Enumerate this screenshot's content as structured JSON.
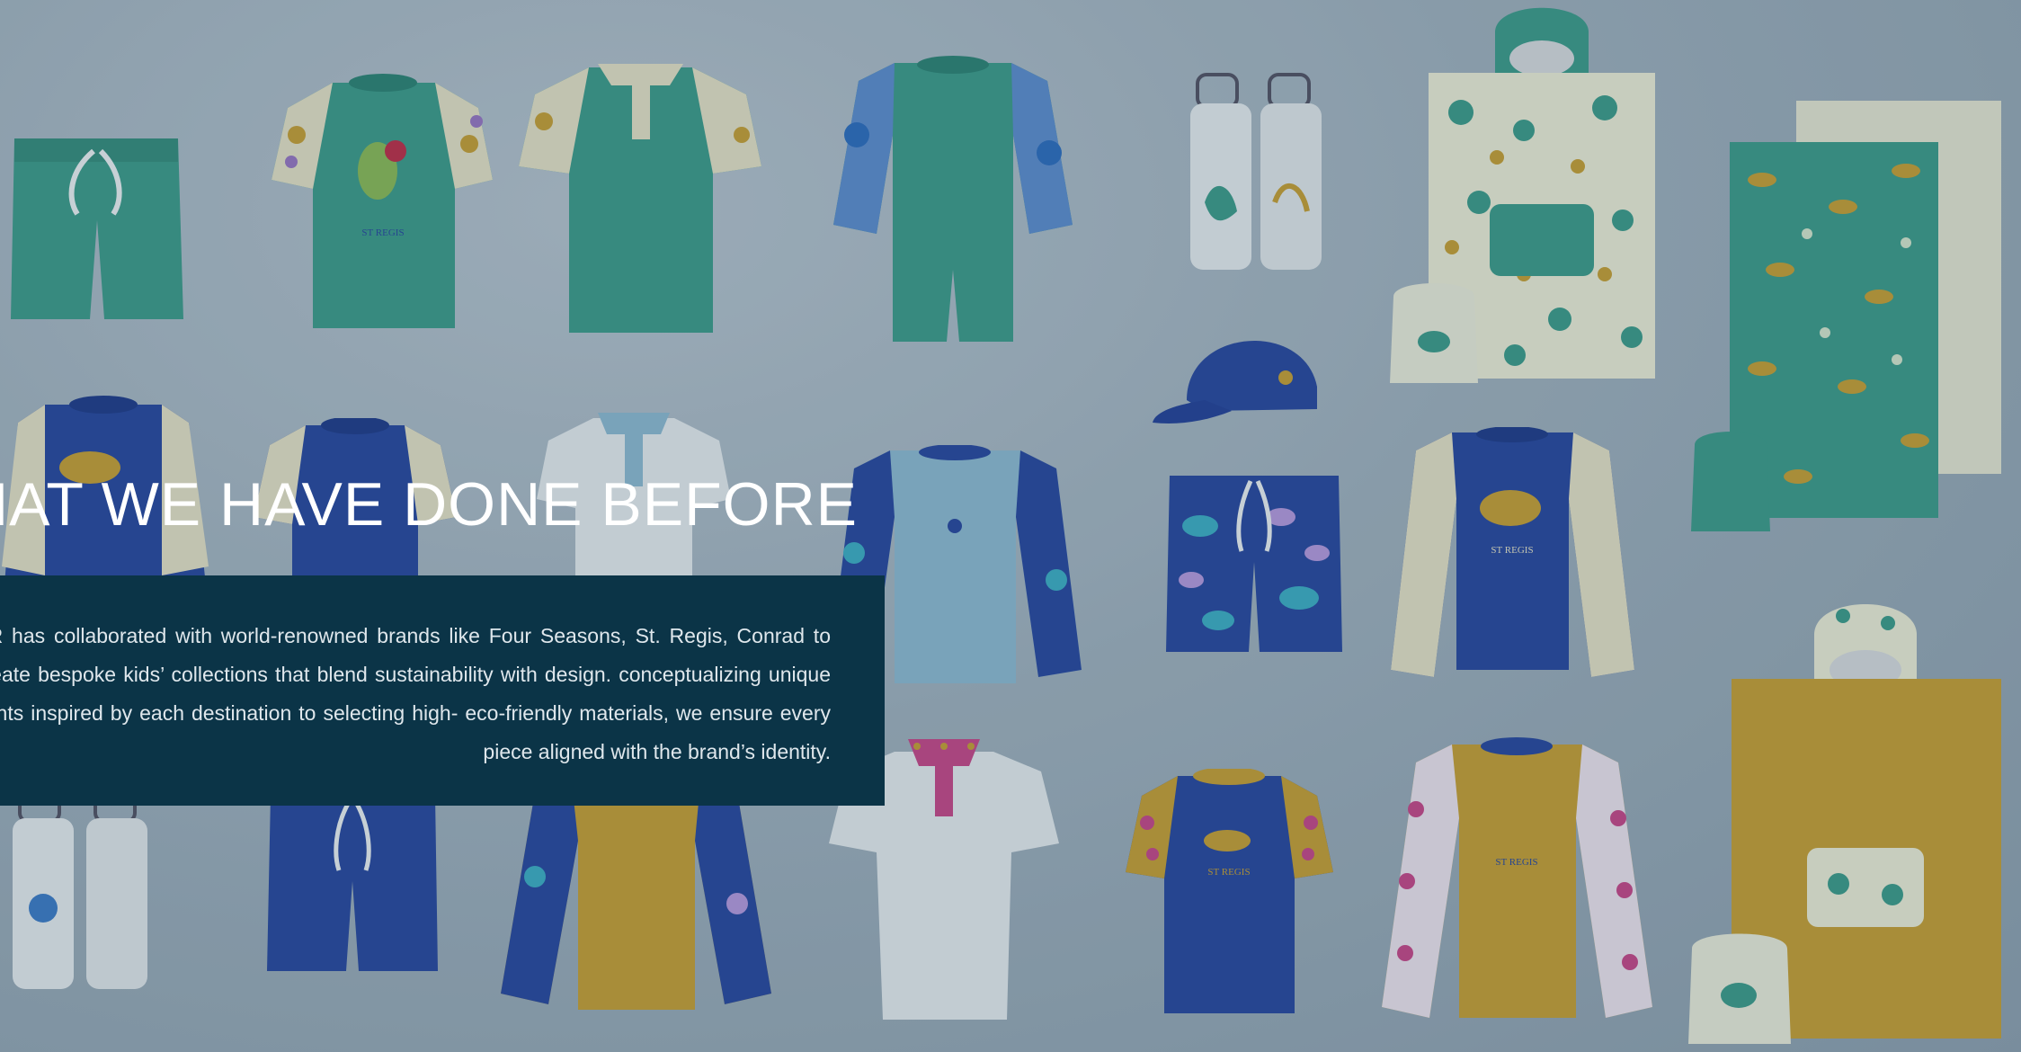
{
  "section": {
    "headline": "HAT WE HAVE DONE BEFORE",
    "body": "NR has collaborated with world-renowned brands like Four Seasons, St. Regis, Conrad to create bespoke kids’ collections that blend sustainability with design. conceptualizing unique prints inspired by each destination to selecting high- eco-friendly materials, we ensure every piece aligned with the brand’s identity."
  },
  "colors": {
    "background": "#9fb0bd",
    "panel": "#0b3447",
    "teal": "#3f9e8c",
    "navy": "#2a4aa0",
    "mustard": "#c9a236",
    "light_blue": "#8fbcd4",
    "white_garment": "#e8eef1"
  },
  "products": {
    "logo_text": "ST REGIS",
    "items": [
      {
        "name": "teal-swim-shorts",
        "icon": "shorts-icon"
      },
      {
        "name": "teal-bird-rash-tee",
        "icon": "tshirt-icon"
      },
      {
        "name": "teal-polo",
        "icon": "polo-icon"
      },
      {
        "name": "teal-sunsuit",
        "icon": "sunsuit-icon"
      },
      {
        "name": "white-water-bottles",
        "icon": "bottle-icon"
      },
      {
        "name": "navy-cap",
        "icon": "cap-icon"
      },
      {
        "name": "printed-hooded-poncho",
        "icon": "poncho-icon"
      },
      {
        "name": "beach-towels",
        "icon": "towel-icon"
      },
      {
        "name": "navy-turtle-rash-guard",
        "icon": "rash-guard-icon"
      },
      {
        "name": "navy-rash-tee",
        "icon": "tshirt-icon"
      },
      {
        "name": "white-polo",
        "icon": "polo-icon"
      },
      {
        "name": "light-blue-rash-guard",
        "icon": "rash-guard-icon"
      },
      {
        "name": "navy-turtle-shorts",
        "icon": "shorts-icon"
      },
      {
        "name": "navy-rash-guard-right",
        "icon": "rash-guard-icon"
      },
      {
        "name": "navy-shorts",
        "icon": "shorts-icon"
      },
      {
        "name": "mustard-rash-guard",
        "icon": "rash-guard-icon"
      },
      {
        "name": "white-polo-pink-collar",
        "icon": "polo-icon"
      },
      {
        "name": "navy-bird-rash-tee",
        "icon": "tshirt-icon"
      },
      {
        "name": "mustard-bird-rash-guard",
        "icon": "rash-guard-icon"
      },
      {
        "name": "mustard-hooded-poncho",
        "icon": "poncho-icon"
      },
      {
        "name": "drawstring-bag",
        "icon": "bag-icon"
      }
    ]
  }
}
